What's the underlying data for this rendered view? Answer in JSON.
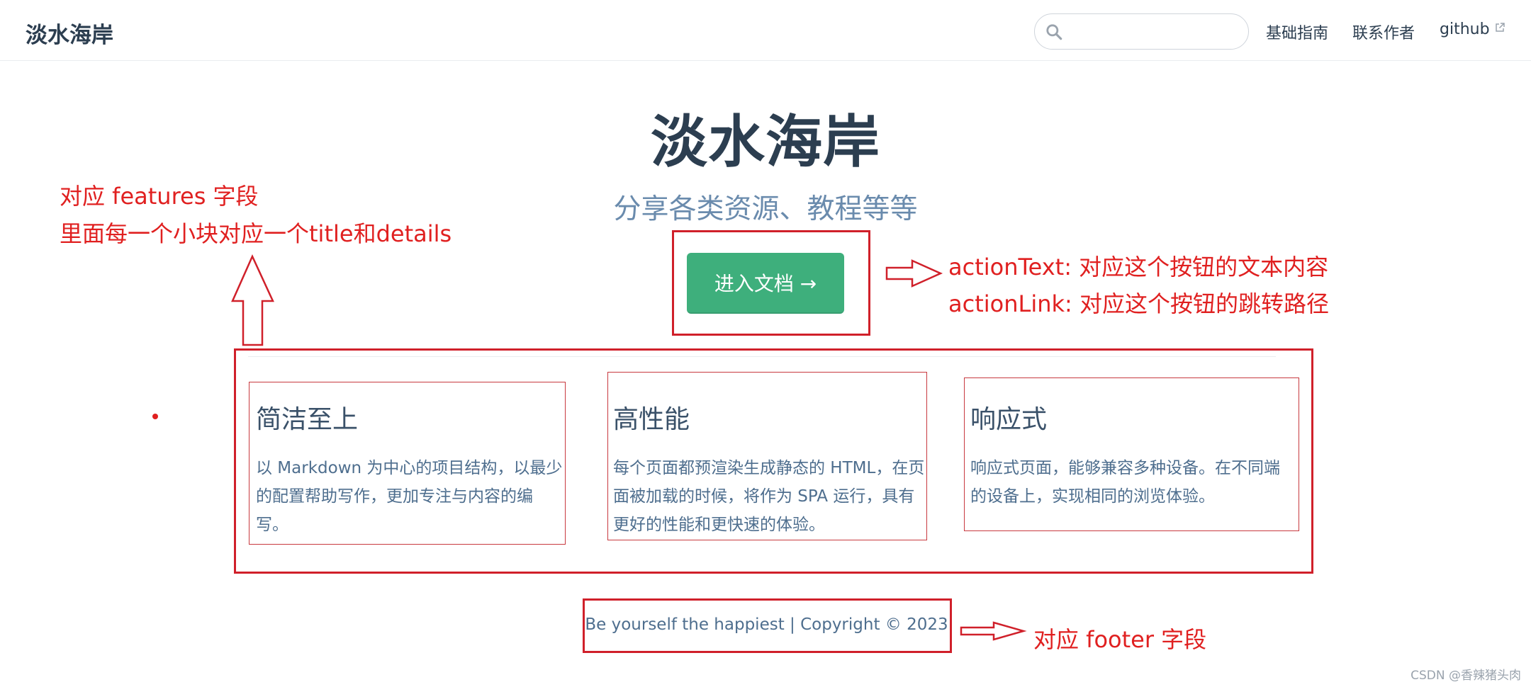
{
  "navbar": {
    "site_name": "淡水海岸",
    "search": {
      "value": "",
      "placeholder": ""
    },
    "links": [
      {
        "label": "基础指南"
      },
      {
        "label": "联系作者"
      },
      {
        "label": "github"
      }
    ]
  },
  "hero": {
    "title": "淡水海岸",
    "tagline": "分享各类资源、教程等等",
    "action_text": "进入文档 →"
  },
  "features": [
    {
      "title": "简洁至上",
      "details": "以 Markdown 为中心的项目结构，以最少的配置帮助写作，更加专注与内容的编写。"
    },
    {
      "title": "高性能",
      "details": "每个页面都预渲染生成静态的 HTML，在页面被加载的时候，将作为 SPA 运行，具有更好的性能和更快速的体验。"
    },
    {
      "title": "响应式",
      "details": "响应式页面，能够兼容多种设备。在不同端的设备上，实现相同的浏览体验。"
    }
  ],
  "footer": {
    "text": "Be yourself the happiest | Copyright © 2023"
  },
  "annotations": {
    "features_line1": "对应 features 字段",
    "features_line2": "里面每一个小块对应一个title和details",
    "action_text_note": "actionText: 对应这个按钮的文本内容",
    "action_link_note": "actionLink: 对应这个按钮的跳转路径",
    "footer_note": "对应 footer 字段",
    "color": "#e02020"
  },
  "watermark": "CSDN @香辣猪头肉",
  "colors": {
    "accent": "#3eaf7c",
    "text": "#2c3e50",
    "tagline": "#6a8bad"
  }
}
